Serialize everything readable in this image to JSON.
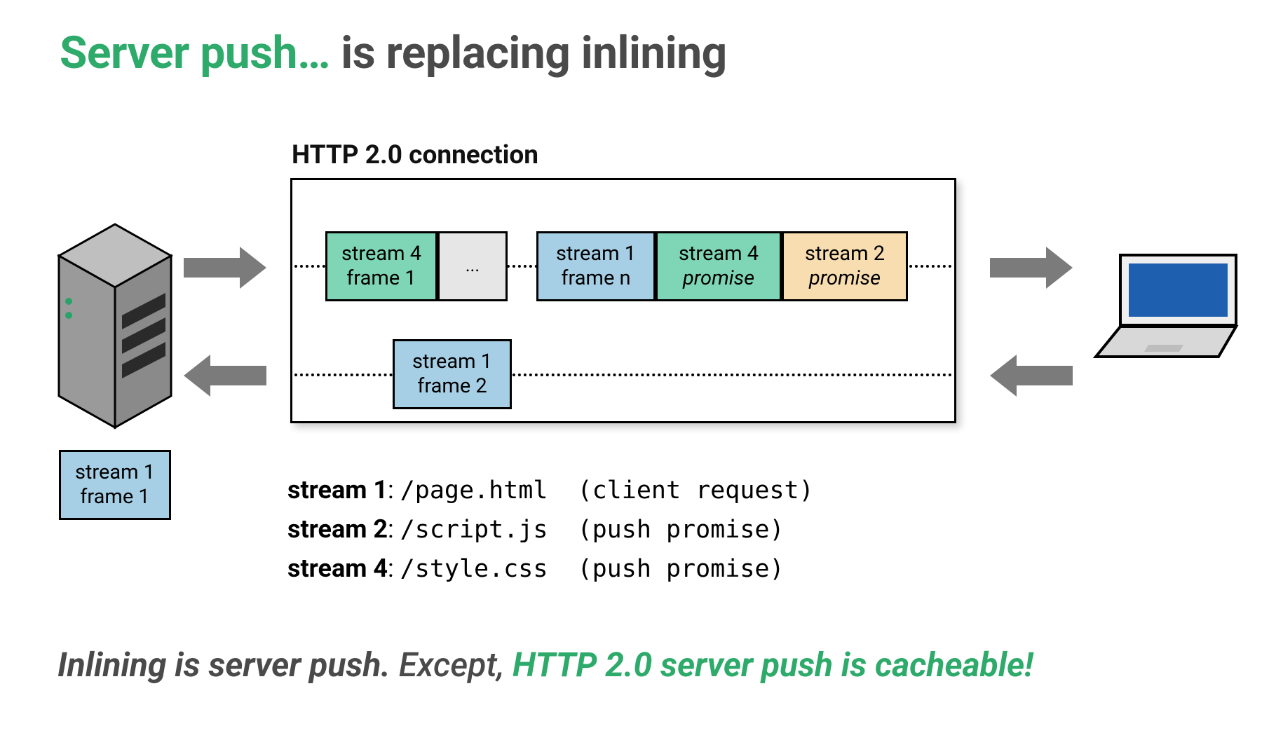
{
  "title": {
    "accent": "Server push…",
    "rest": " is replacing inlining"
  },
  "conn_label": "HTTP 2.0 connection",
  "frames": {
    "f1_l1": "stream 4",
    "f1_l2": "frame 1",
    "f2": "...",
    "f3_l1": "stream 1",
    "f3_l2": "frame n",
    "f4_l1": "stream 4",
    "f4_l2": "promise",
    "f5_l1": "stream 2",
    "f5_l2": "promise",
    "f6_l1": "stream 1",
    "f6_l2": "frame 2",
    "f7_l1": "stream 1",
    "f7_l2": "frame 1"
  },
  "legend": {
    "r1_lbl": "stream 1",
    "r1_sep": ": ",
    "r1_path": "/page.html",
    "r1_note": "  (client request)",
    "r2_lbl": "stream 2",
    "r2_sep": ": ",
    "r2_path": "/script.js",
    "r2_note": "  (push promise)",
    "r3_lbl": "stream 4",
    "r3_sep": ": ",
    "r3_path": "/style.css",
    "r3_note": "  (push promise)"
  },
  "footer": {
    "p1": "Inlining is server push.",
    "p2": " Except, ",
    "p3": "HTTP 2.0 server push is cacheable!"
  },
  "watermark": {
    "line1": "",
    "line2": ""
  },
  "colors": {
    "green": "#7fd6b7",
    "blue": "#a6cfe6",
    "grey": "#e6e6e6",
    "orange": "#f8ddb0",
    "accent_text": "#2eaa6b"
  }
}
